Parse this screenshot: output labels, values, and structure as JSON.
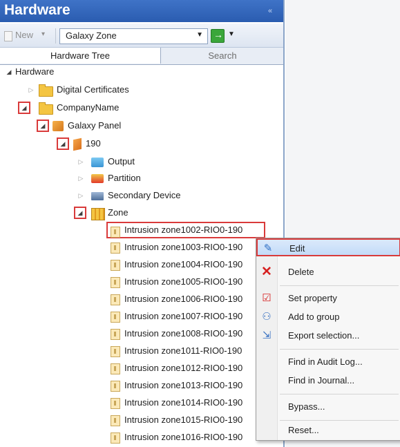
{
  "panel": {
    "title": "Hardware",
    "toolbar": {
      "new_label": "New",
      "zone_select_value": "Galaxy Zone"
    },
    "tabs": [
      {
        "label": "Hardware Tree",
        "active": true
      },
      {
        "label": "Search",
        "active": false
      }
    ]
  },
  "tree": {
    "root": "Hardware",
    "digital_certificates": "Digital Certificates",
    "company": "CompanyName",
    "galaxy_panel": "Galaxy Panel",
    "unit": "190",
    "output": "Output",
    "partition": "Partition",
    "secondary_device": "Secondary Device",
    "zone": "Zone",
    "zone_items": [
      "Intrusion zone1002-RIO0-190",
      "Intrusion zone1003-RIO0-190",
      "Intrusion zone1004-RIO0-190",
      "Intrusion zone1005-RIO0-190",
      "Intrusion zone1006-RIO0-190",
      "Intrusion zone1007-RIO0-190",
      "Intrusion zone1008-RIO0-190",
      "Intrusion zone1011-RIO0-190",
      "Intrusion zone1012-RIO0-190",
      "Intrusion zone1013-RIO0-190",
      "Intrusion zone1014-RIO0-190",
      "Intrusion zone1015-RIO0-190",
      "Intrusion zone1016-RIO0-190"
    ]
  },
  "context_menu": {
    "edit": "Edit",
    "delete": "Delete",
    "set_property": "Set property",
    "add_to_group": "Add to group",
    "export_selection": "Export selection...",
    "find_audit_log": "Find in Audit Log...",
    "find_journal": "Find in Journal...",
    "bypass": "Bypass...",
    "reset": "Reset..."
  },
  "colors": {
    "title_bar": "#2f63b8",
    "highlight_box": "#d93a3a",
    "delete_icon": "#d62020"
  }
}
